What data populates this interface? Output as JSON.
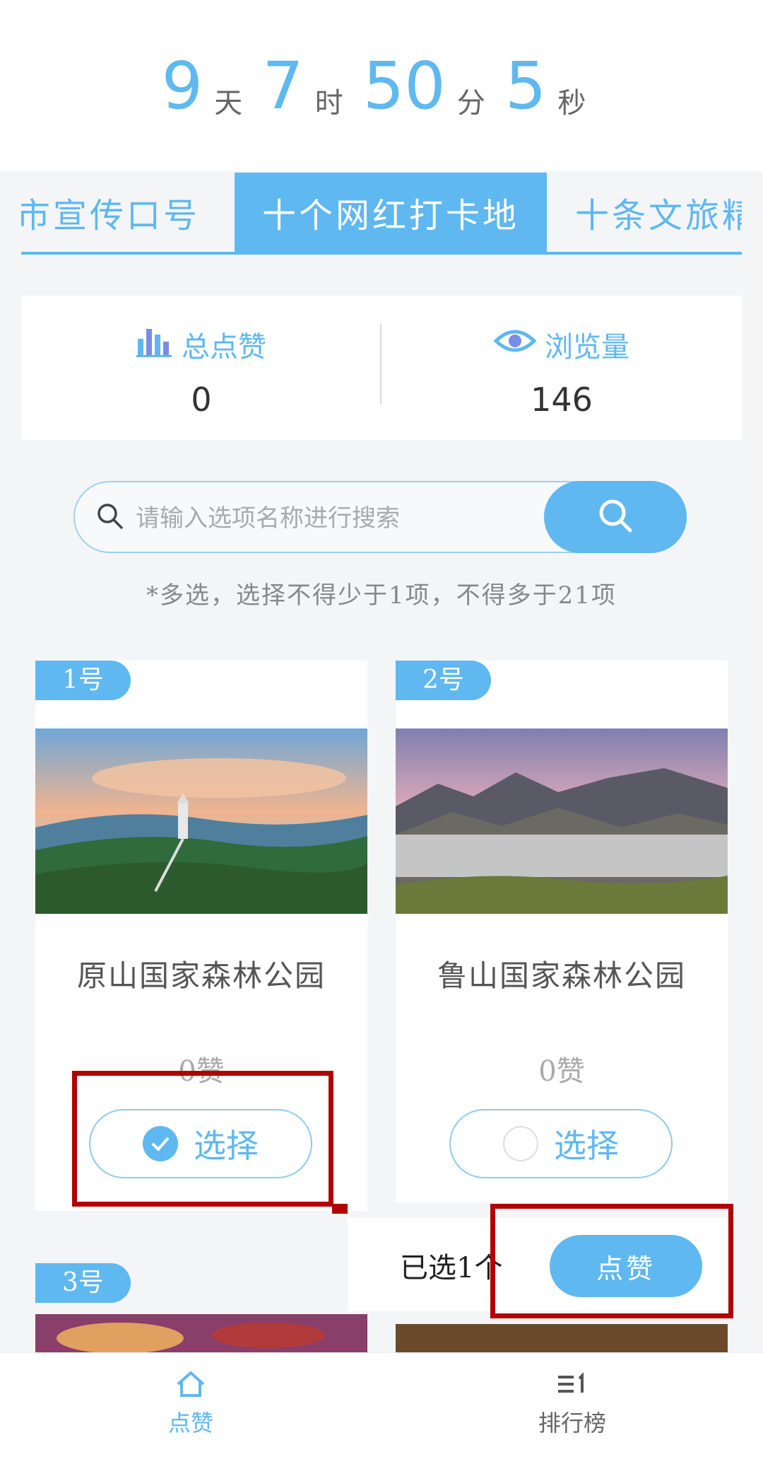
{
  "countdown": {
    "days": "9",
    "days_unit": "天",
    "hours": "7",
    "hours_unit": "时",
    "minutes": "50",
    "minutes_unit": "分",
    "seconds": "5",
    "seconds_unit": "秒"
  },
  "tabs": [
    {
      "label": "城市宣传口号"
    },
    {
      "label": "十个网红打卡地"
    },
    {
      "label": "十条文旅精品"
    }
  ],
  "stats": {
    "likes_label": "总点赞",
    "likes_value": "0",
    "views_label": "浏览量",
    "views_value": "146"
  },
  "search": {
    "placeholder": "请输入选项名称进行搜索"
  },
  "hint": "*多选，选择不得少于1项，不得多于21项",
  "cards": [
    {
      "badge": "1号",
      "title": "原山国家森林公园",
      "likes": "0赞",
      "choose_label": "选择",
      "selected": true
    },
    {
      "badge": "2号",
      "title": "鲁山国家森林公园",
      "likes": "0赞",
      "choose_label": "选择",
      "selected": false
    },
    {
      "badge": "3号"
    }
  ],
  "selection_bar": {
    "selected_text": "已选1个",
    "like_button": "点赞"
  },
  "bottom_nav": [
    {
      "label": "点赞",
      "icon": "home-icon",
      "active": true
    },
    {
      "label": "排行榜",
      "icon": "ranking-icon",
      "active": false
    }
  ],
  "colors": {
    "accent": "#5fb8ef",
    "annotation": "#b20000"
  }
}
